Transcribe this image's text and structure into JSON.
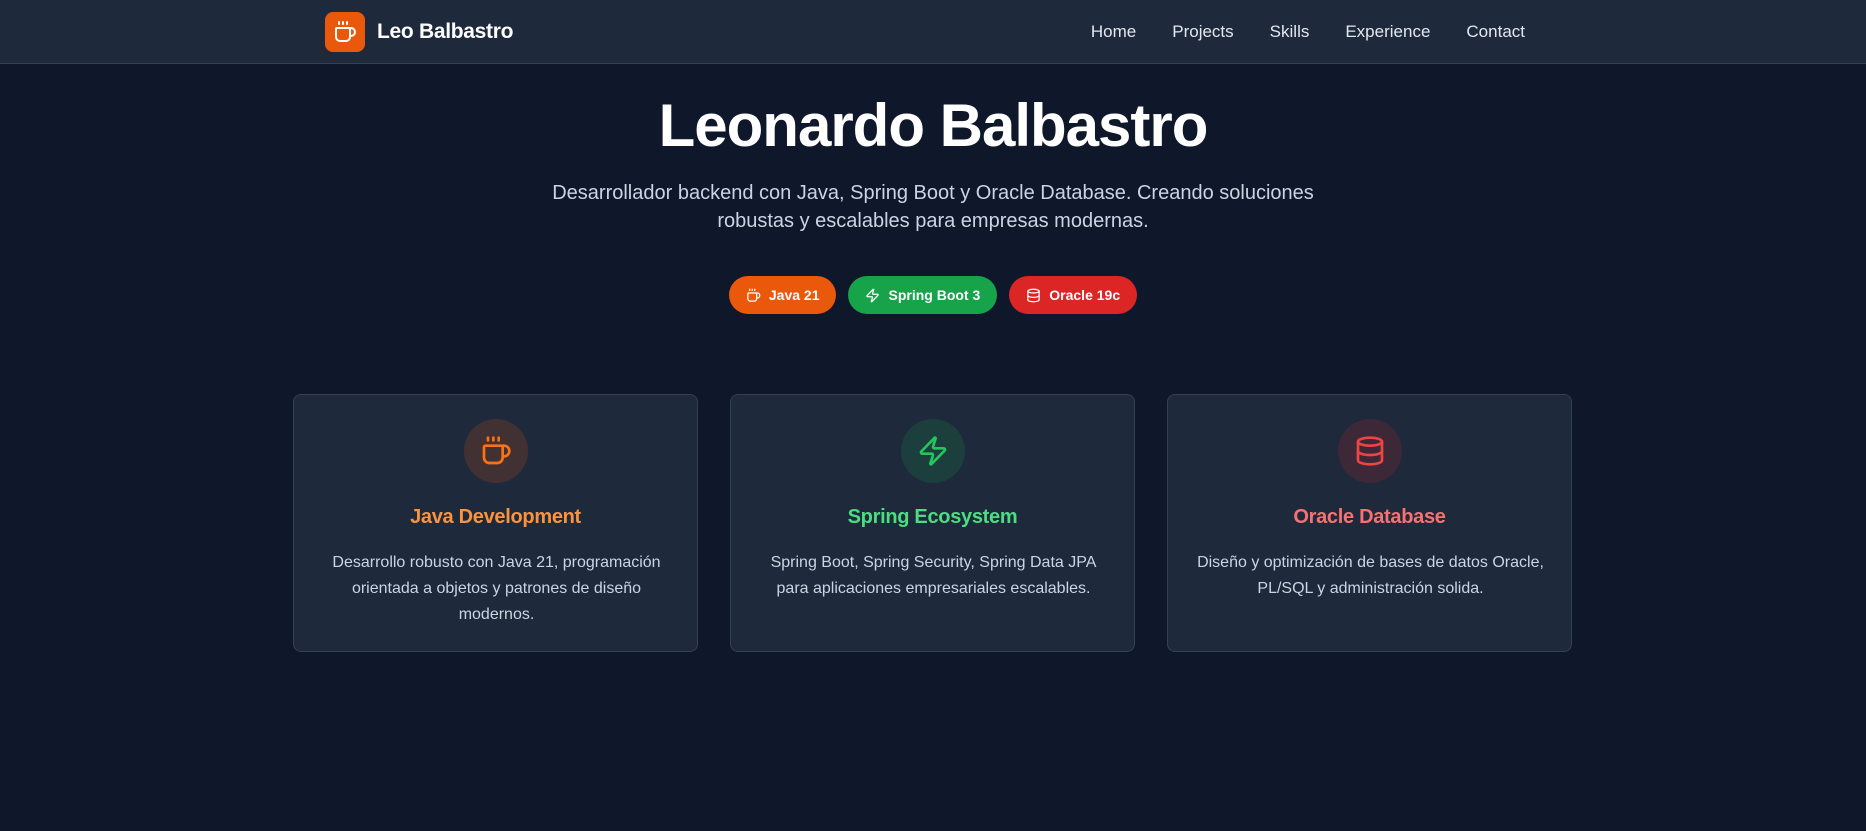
{
  "nav": {
    "brand": "Leo Balbastro",
    "logo_icon": "coffee-cup-icon",
    "links": [
      "Home",
      "Projects",
      "Skills",
      "Experience",
      "Contact"
    ]
  },
  "hero": {
    "title": "Leonardo Balbastro",
    "subtitle": "Desarrollador backend con Java, Spring Boot y Oracle Database. Creando soluciones robustas y escalables para empresas modernas.",
    "badges": [
      {
        "label": "Java 21",
        "icon": "coffee-cup-icon",
        "color": "#ea580c"
      },
      {
        "label": "Spring Boot 3",
        "icon": "lightning-icon",
        "color": "#16a34a"
      },
      {
        "label": "Oracle 19c",
        "icon": "database-icon",
        "color": "#dc2626"
      }
    ]
  },
  "cards": [
    {
      "title": "Java Development",
      "text": "Desarrollo robusto con Java 21, programación orientada a objetos y patrones de diseño modernos.",
      "icon": "coffee-cup-icon",
      "color": "#fb923c"
    },
    {
      "title": "Spring Ecosystem",
      "text": "Spring Boot, Spring Security, Spring Data JPA para aplicaciones empresariales escalables.",
      "icon": "lightning-icon",
      "color": "#4ade80"
    },
    {
      "title": "Oracle Database",
      "text": "Diseño y optimización de bases de datos Oracle, PL/SQL y administración solida.",
      "icon": "database-icon",
      "color": "#f87171"
    }
  ],
  "colors": {
    "background": "#0f172a",
    "surface": "#1e293b",
    "border": "#334155",
    "accent_java": "#ea580c",
    "accent_spring": "#16a34a",
    "accent_oracle": "#dc2626"
  }
}
